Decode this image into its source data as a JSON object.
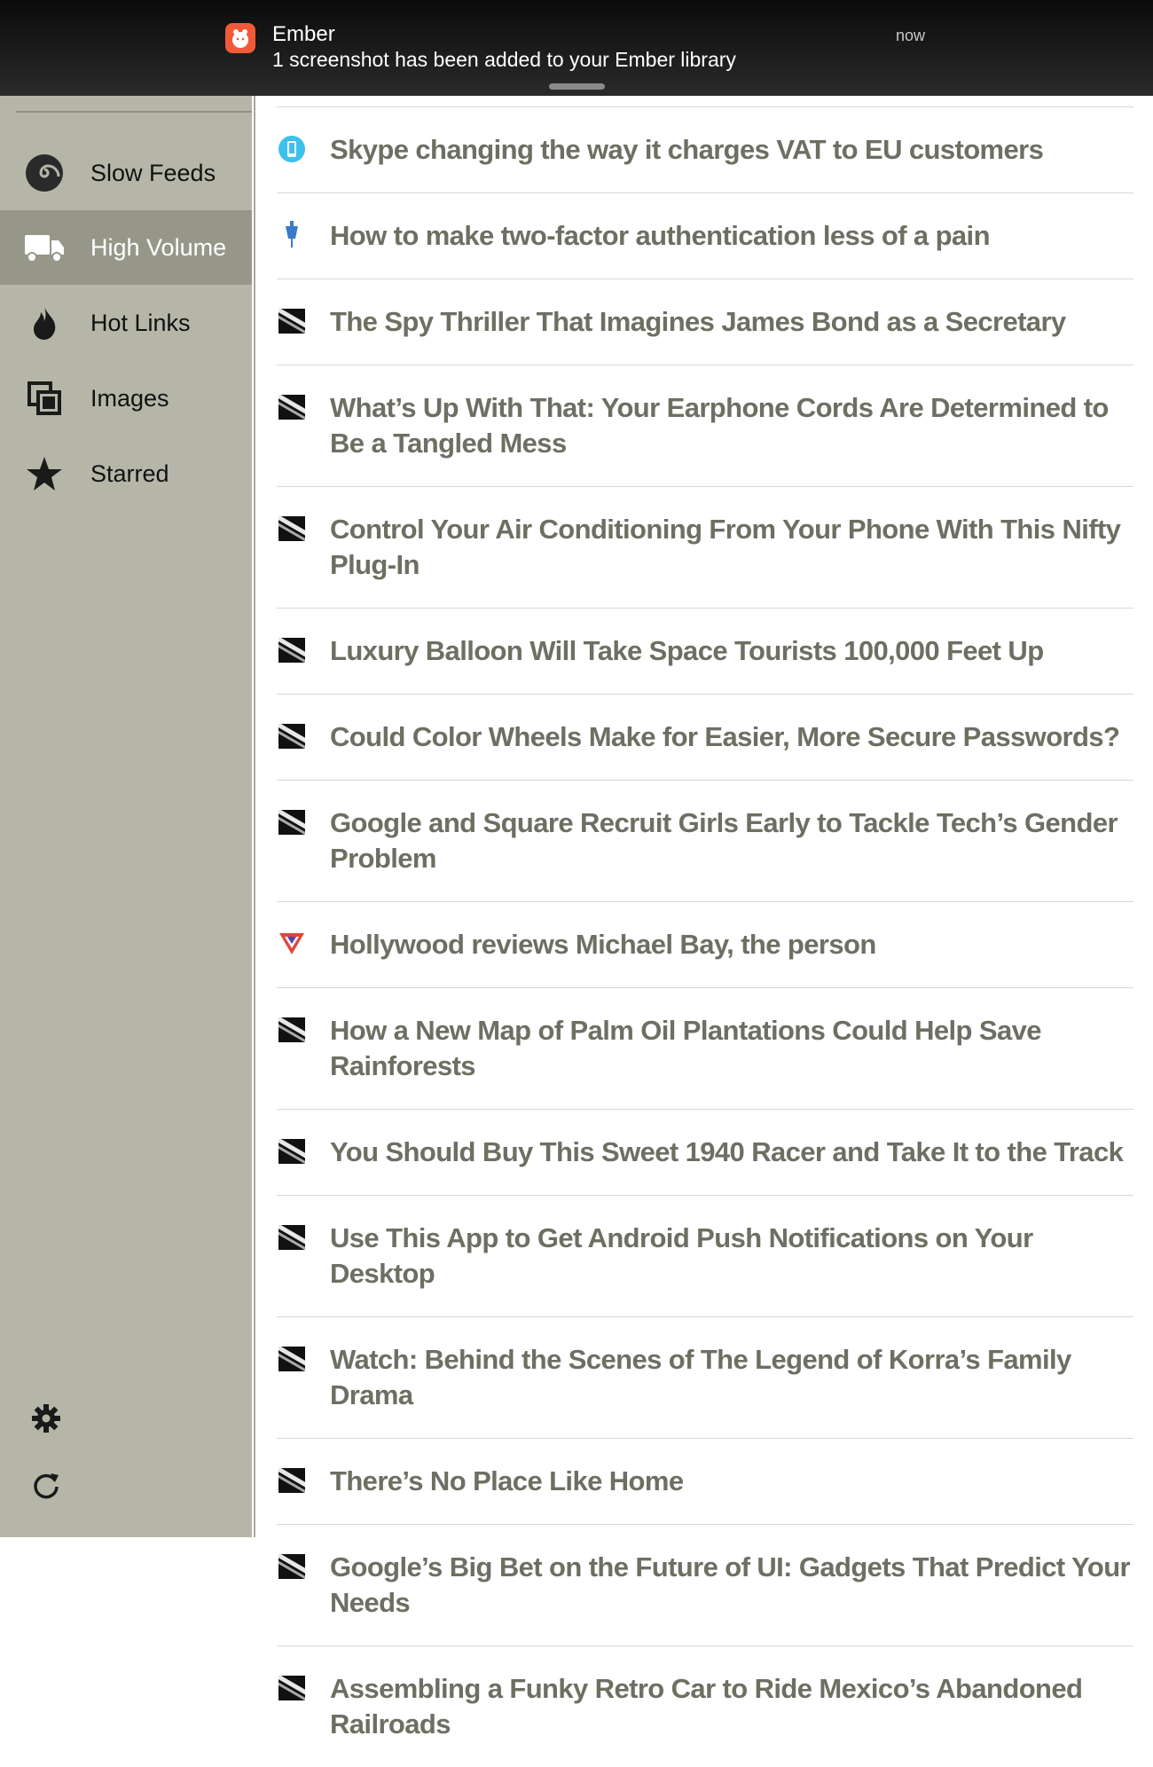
{
  "notification": {
    "app_name": "Ember",
    "message": "1 screenshot has been added to your Ember library",
    "time": "now"
  },
  "sidebar": {
    "items": [
      {
        "label": "Slow Feeds",
        "icon": "spiral-icon",
        "active": false
      },
      {
        "label": "High Volume",
        "icon": "truck-icon",
        "active": true
      },
      {
        "label": "Hot Links",
        "icon": "flame-icon",
        "active": false
      },
      {
        "label": "Images",
        "icon": "images-icon",
        "active": false
      },
      {
        "label": "Starred",
        "icon": "star-icon",
        "active": false
      }
    ],
    "bottom_icons": [
      "gear-icon",
      "refresh-icon"
    ]
  },
  "articles": [
    {
      "title": "Skype changing the way it charges VAT to EU customers",
      "favicon": "skype-phone-icon"
    },
    {
      "title": "How to make two-factor authentication less of a pain",
      "favicon": "blue-pin-icon"
    },
    {
      "title": "The Spy Thriller That Imagines James Bond as a Secretary",
      "favicon": "wired-icon"
    },
    {
      "title": "What’s Up With That: Your Earphone Cords Are Determined to Be a Tangled Mess",
      "favicon": "wired-icon"
    },
    {
      "title": "Control Your Air Conditioning From Your Phone With This Nifty Plug-In",
      "favicon": "wired-icon"
    },
    {
      "title": "Luxury Balloon Will Take Space Tourists 100,000 Feet Up",
      "favicon": "wired-icon"
    },
    {
      "title": "Could Color Wheels Make for Easier, More Secure Passwords?",
      "favicon": "wired-icon"
    },
    {
      "title": "Google and Square Recruit Girls Early to Tackle Tech’s Gender Problem",
      "favicon": "wired-icon"
    },
    {
      "title": "Hollywood reviews Michael Bay, the person",
      "favicon": "verge-icon"
    },
    {
      "title": "How a New Map of Palm Oil Plantations Could Help Save Rainforests",
      "favicon": "wired-icon"
    },
    {
      "title": "You Should Buy This Sweet 1940 Racer and Take It to the Track",
      "favicon": "wired-icon"
    },
    {
      "title": "Use This App to Get Android Push Notifications on Your Desktop",
      "favicon": "wired-icon"
    },
    {
      "title": "Watch: Behind the Scenes of The Legend of Korra’s Family Drama",
      "favicon": "wired-icon"
    },
    {
      "title": "There’s No Place Like Home",
      "favicon": "wired-icon"
    },
    {
      "title": "Google’s Big Bet on the Future of UI: Gadgets That Predict Your Needs",
      "favicon": "wired-icon"
    },
    {
      "title": "Assembling a Funky Retro Car to Ride Mexico’s Abandoned Railroads",
      "favicon": "wired-icon"
    }
  ]
}
